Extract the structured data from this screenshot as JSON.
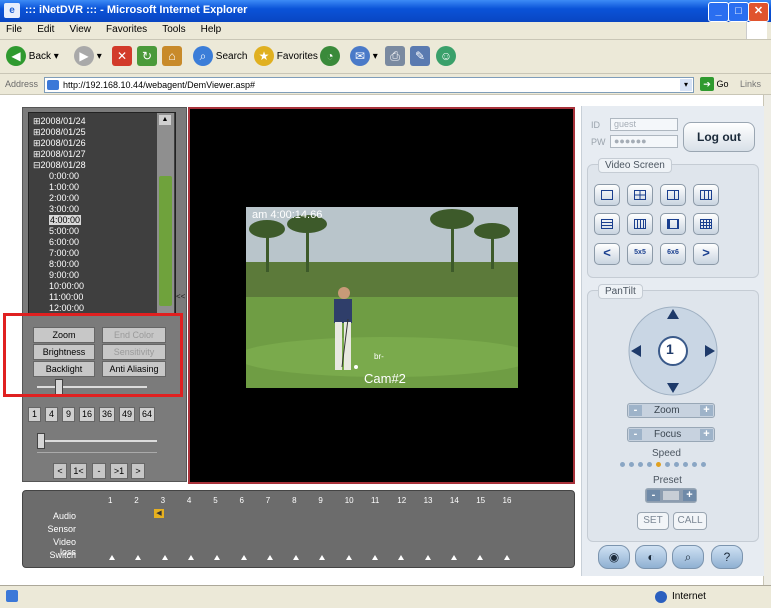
{
  "window": {
    "title": "::: iNetDVR ::: - Microsoft Internet Explorer"
  },
  "menu": [
    "File",
    "Edit",
    "View",
    "Favorites",
    "Tools",
    "Help"
  ],
  "toolbar": {
    "back": "Back",
    "search": "Search",
    "favorites": "Favorites"
  },
  "address": {
    "label": "Address",
    "url": "http://192.168.10.44/webagent/DemViewer.asp#",
    "go": "Go",
    "links": "Links"
  },
  "status": {
    "zone": "Internet"
  },
  "tree": {
    "dates": [
      "2008/01/24",
      "2008/01/25",
      "2008/01/26",
      "2008/01/27",
      "2008/01/28"
    ],
    "date_expanders": [
      "⊞",
      "⊞",
      "⊞",
      "⊞",
      "⊟"
    ],
    "times": [
      "0:00:00",
      "1:00:00",
      "2:00:00",
      "3:00:00",
      "4:00:00",
      "5:00:00",
      "6:00:00",
      "7:00:00",
      "8:00:00",
      "9:00:00",
      "10:00:00",
      "11:00:00",
      "12:00:00"
    ],
    "selected_time": "4:00:00"
  },
  "collapse": "<<",
  "image_controls": {
    "zoom": "Zoom",
    "end_color": "End Color",
    "brightness": "Brightness",
    "sensitivity": "Sensitivity",
    "backlight": "Backlight",
    "anti_aliasing": "Anti Aliasing"
  },
  "layout_buttons": [
    "1",
    "4",
    "9",
    "16",
    "36",
    "49",
    "64"
  ],
  "playback": {
    "prev_end": "<",
    "prev": "1<",
    "dash": "-",
    "next": ">1",
    "next_end": ">"
  },
  "video": {
    "timestamp": "am 4:00:14.66",
    "camera_label": "Cam#2",
    "overlay": "br-"
  },
  "channels": [
    "1",
    "2",
    "3",
    "4",
    "5",
    "6",
    "7",
    "8",
    "9",
    "10",
    "11",
    "12",
    "13",
    "14",
    "15",
    "16"
  ],
  "status_rows": [
    "Audio",
    "Sensor",
    "Video loss",
    "Switch"
  ],
  "login": {
    "id_label": "ID",
    "id_value": "guest",
    "pw_label": "PW",
    "pw_value": "●●●●●●",
    "logout": "Log out"
  },
  "video_screen": {
    "title": "Video Screen",
    "split_5x5": "5x5",
    "split_6x6": "6x6",
    "prev": "<",
    "next": ">"
  },
  "pantilt": {
    "title": "PanTilt",
    "center": "1",
    "zoom": "Zoom",
    "focus": "Focus",
    "minus": "-",
    "plus": "+",
    "speed": "Speed",
    "preset": "Preset",
    "preset_value": "",
    "set": "SET",
    "call": "CALL",
    "speed_level": 5,
    "speed_steps": 10
  },
  "colors": {
    "frame_border": "#a8323a",
    "highlight": "#e02020",
    "panel": "#7b7b7b"
  }
}
